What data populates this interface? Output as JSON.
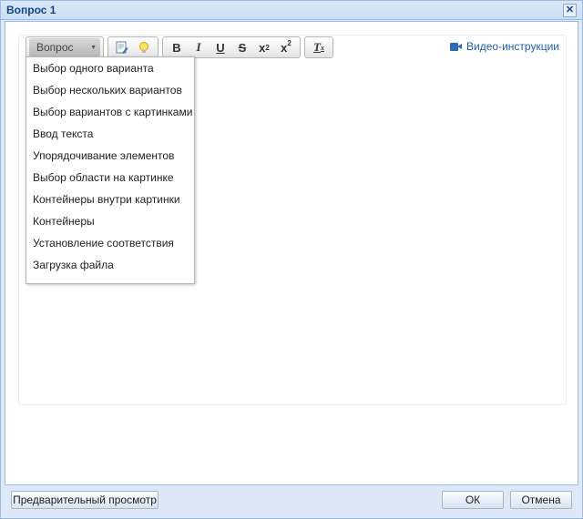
{
  "window": {
    "title": "Вопрос 1",
    "close_symbol": "✕"
  },
  "toolbar": {
    "question_type_combo": "Вопрос",
    "buttons": {
      "bold": "B",
      "italic": "I",
      "underline": "U",
      "strike": "S",
      "subscript": "x",
      "superscript": "x",
      "clear_format": "T"
    }
  },
  "video_link": "Видео-инструкции",
  "dropdown": {
    "items": [
      "Выбор одного варианта",
      "Выбор нескольких вариантов",
      "Выбор вариантов с картинками",
      "Ввод текста",
      "Упорядочивание элементов",
      "Выбор области на картинке",
      "Контейнеры внутри картинки",
      "Контейнеры",
      "Установление соответствия",
      "Загрузка файла"
    ]
  },
  "footer": {
    "preview": "Предварительный просмотр",
    "ok": "ОК",
    "cancel": "Отмена"
  },
  "colors": {
    "title": "#15428b",
    "link": "#1c5fb0",
    "frame": "#99bbe8"
  }
}
